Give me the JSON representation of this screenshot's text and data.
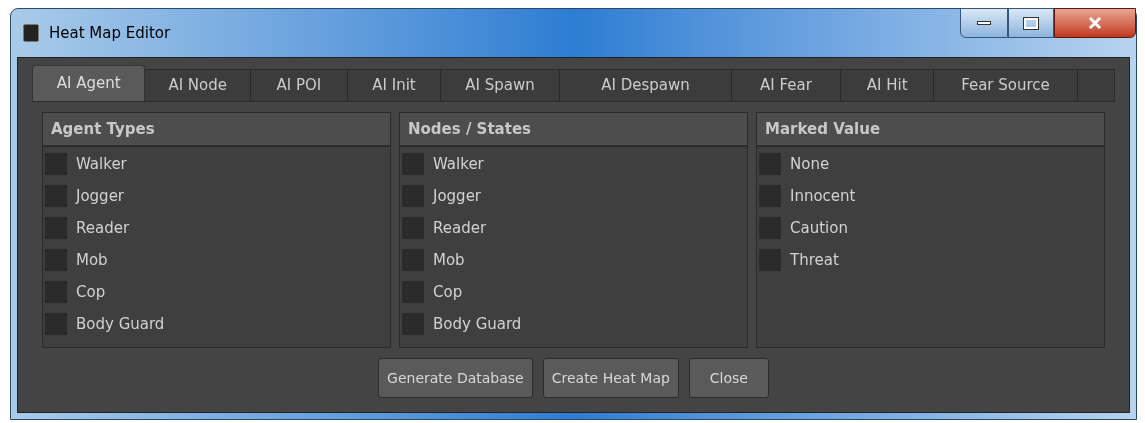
{
  "window": {
    "title": "Heat Map Editor"
  },
  "tabs": [
    {
      "label": "AI Agent",
      "selected": true
    },
    {
      "label": "AI Node",
      "selected": false
    },
    {
      "label": "AI POI",
      "selected": false
    },
    {
      "label": "AI Init",
      "selected": false
    },
    {
      "label": "AI Spawn",
      "selected": false
    },
    {
      "label": "AI Despawn",
      "selected": false
    },
    {
      "label": "AI Fear",
      "selected": false
    },
    {
      "label": "AI Hit",
      "selected": false
    },
    {
      "label": "Fear Source",
      "selected": false
    }
  ],
  "panels": [
    {
      "title": "Agent Types",
      "items": [
        {
          "label": "Walker",
          "checked": false
        },
        {
          "label": "Jogger",
          "checked": false
        },
        {
          "label": "Reader",
          "checked": false
        },
        {
          "label": "Mob",
          "checked": false
        },
        {
          "label": "Cop",
          "checked": false
        },
        {
          "label": "Body Guard",
          "checked": false
        }
      ]
    },
    {
      "title": "Nodes / States",
      "items": [
        {
          "label": "Walker",
          "checked": false
        },
        {
          "label": "Jogger",
          "checked": false
        },
        {
          "label": "Reader",
          "checked": false
        },
        {
          "label": "Mob",
          "checked": false
        },
        {
          "label": "Cop",
          "checked": false
        },
        {
          "label": "Body Guard",
          "checked": false
        }
      ]
    },
    {
      "title": "Marked Value",
      "items": [
        {
          "label": "None",
          "checked": false
        },
        {
          "label": "Innocent",
          "checked": false
        },
        {
          "label": "Caution",
          "checked": false
        },
        {
          "label": "Threat",
          "checked": false
        }
      ]
    }
  ],
  "buttons": [
    "Generate Database",
    "Create Heat Map",
    "Close"
  ]
}
